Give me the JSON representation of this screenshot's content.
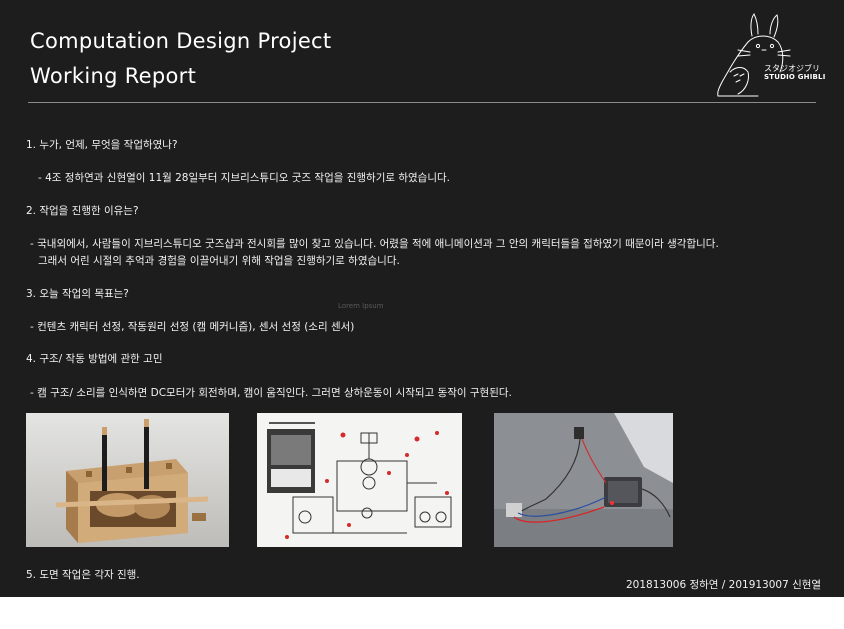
{
  "header": {
    "title_line1": "Computation Design Project",
    "title_line2": "Working Report"
  },
  "logo": {
    "icon": "totoro-icon",
    "text_jp": "スタジオジブリ",
    "text_en": "STUDIO GHIBLI"
  },
  "sections": {
    "q1": "1. 누가, 언제, 무엇을 작업하였나?",
    "a1": "- 4조 정하연과 신현열이 11월 28일부터 지브리스튜디오 굿즈 작업을 진행하기로 하였습니다.",
    "q2": "2. 작업을 진행한 이유는?",
    "a2_line1": "- 국내외에서, 사람들이 지브리스튜디오 굿즈샵과 전시회를 많이 찾고 있습니다. 어렸을 적에 애니메이션과 그 안의 캐릭터들을 접하였기 때문이라 생각합니다.",
    "a2_line2": "그래서 어린 시절의 추억과 경험을 이끌어내기 위해 작업을 진행하기로 하였습니다.",
    "q3": "3. 오늘 작업의 목표는?",
    "a3": "- 컨텐츠 캐릭터 선정, 작동원리 선정 (캠 메커니즘), 센서 선정 (소리 센서)",
    "q4": "4. 구조/ 작동 방법에 관한 고민",
    "a4": "- 캠 구조/ 소리를 인식하면 DC모터가 회전하며, 캠이 움직인다. 그러면 상하운동이 시작되고  동작이 구현된다.",
    "q5": "5. 도면 작업은 각자 진행."
  },
  "faint_text": "Lorem Ipsum",
  "footer": {
    "authors": "201813006 정하연  / 201913007 신현열"
  },
  "colors": {
    "background": "#1d1d1d",
    "text": "#f2f2f2",
    "rule": "#8a8a8a"
  }
}
